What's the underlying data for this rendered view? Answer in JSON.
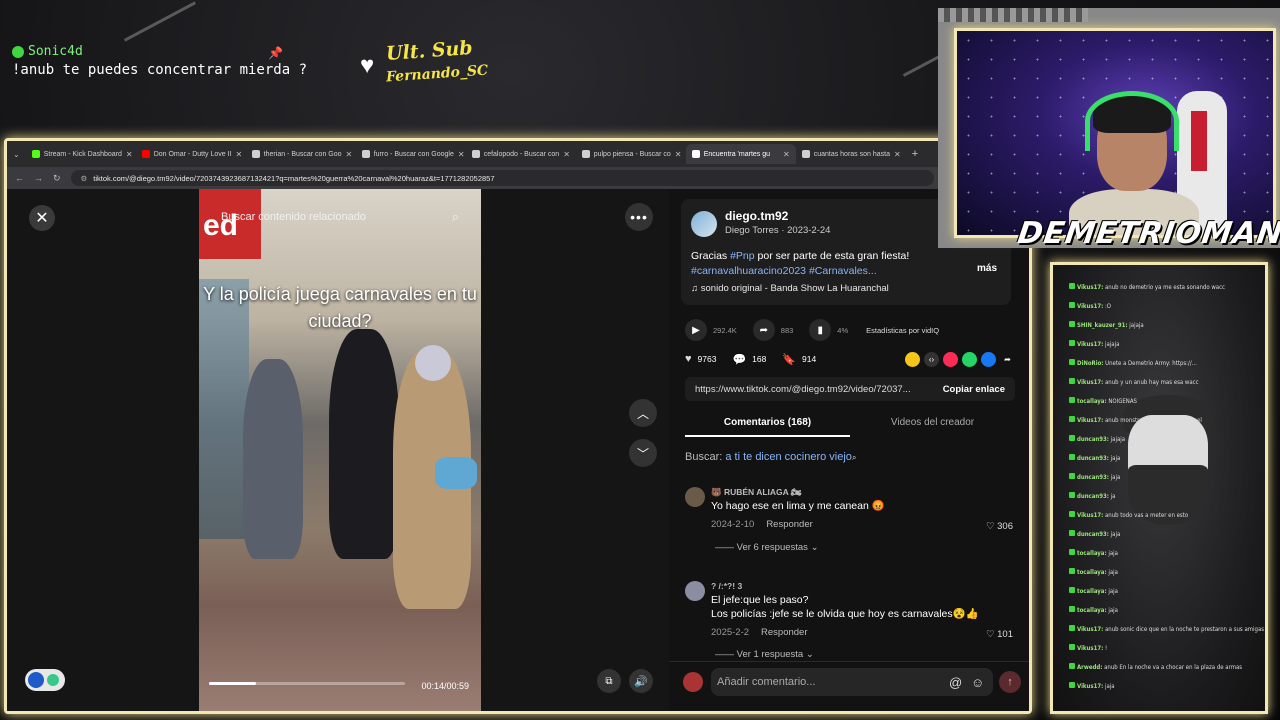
{
  "overlay": {
    "chat_user": "Sonic4d",
    "chat_message": "!anub te puedes concentrar mierda ?",
    "sub_title": "Ult. Sub",
    "sub_name": "Fernando_SC",
    "cam_name": "DEMETRIOMAN...."
  },
  "browser": {
    "tabs": [
      {
        "label": "Stream - Kick Dashboard",
        "color": "#53fc18"
      },
      {
        "label": "Don Omar - Dutty Love II",
        "color": "#ff0000"
      },
      {
        "label": "therian - Buscar con Goo",
        "color": "#cfcfcf"
      },
      {
        "label": "furro - Buscar con Google",
        "color": "#cfcfcf"
      },
      {
        "label": "cefalopodo - Buscar con",
        "color": "#cfcfcf"
      },
      {
        "label": "pulpo piensa - Buscar co",
        "color": "#cfcfcf"
      },
      {
        "label": "Encuentra 'martes gu",
        "color": "#ffffff"
      },
      {
        "label": "cuantas horas son hasta",
        "color": "#cfcfcf"
      }
    ],
    "url": "tiktok.com/@diego.tm92/video/7203743923687132421?q=martes%20guerra%20carnaval%20huaraz&t=1771282052857"
  },
  "video": {
    "search_placeholder": "Buscar contenido relacionado",
    "caption": "Y la policía juega carnavales en tu ciudad?",
    "time": "00:14/00:59",
    "progress": 0.24,
    "store_sign": "ed"
  },
  "post": {
    "handle": "diego.tm92",
    "author_meta": "Diego Torres · 2023-2-24",
    "desc_plain": "Gracias ",
    "desc_tag1": "#Pnp",
    "desc_mid": " por ser parte de esta gran fiesta!",
    "desc_tag2": "#carnavalhuaracino2023",
    "desc_tag3": "#Carnavales...",
    "more": "más",
    "music": "sonido original - Banda Show La Huaranchal",
    "plays": "292.4K",
    "shares_small": "883",
    "pct": "4%",
    "vidiq": "Estadísticas por vidIQ",
    "likes": "9763",
    "comments": "168",
    "saves": "914",
    "link": "https://www.tiktok.com/@diego.tm92/video/72037...",
    "copy_link": "Copiar enlace"
  },
  "comments_section": {
    "tab_comments": "Comentarios (168)",
    "tab_videos": "Videos del creador",
    "search_label": "Buscar:",
    "search_suggestion": "a ti te dicen cocinero viejo",
    "items": [
      {
        "user": "🐻 RUBÉN ALIAGA 🏍",
        "text": "Yo hago ese en lima y me canean 😡",
        "date": "2024-2-10",
        "reply": "Responder",
        "likes": "306",
        "replies": "Ver 6 respuestas"
      },
      {
        "user": "? /:*?! 3",
        "text": "El jefe:que les paso?",
        "text2": "Los policías :jefe se le olvida que hoy es carnavales😵👍",
        "date": "2025-2-2",
        "reply": "Responder",
        "likes": "101",
        "replies": "Ver 1 respuesta"
      }
    ],
    "input_placeholder": "Añadir comentario..."
  },
  "chat_panel": {
    "lines": [
      {
        "user": "Vikus17:",
        "text": "anub no demetrio ya me esta sonando wacc"
      },
      {
        "user": "Vikus17:",
        "text": ":O"
      },
      {
        "user": "SHIN_kauzer_91:",
        "text": "jajaja"
      },
      {
        "user": "Vikus17:",
        "text": "jajaja"
      },
      {
        "user": "DiNoRio:",
        "text": "Unete a Demetrio Army: https://..."
      },
      {
        "user": "Vikus17:",
        "text": "anub y un anub hay mas esa wacc"
      },
      {
        "user": "tocallaya:",
        "text": "NOIGENAS"
      },
      {
        "user": "Vikus17:",
        "text": "anub monstruo de tinta estoy ppoel"
      },
      {
        "user": "duncan93:",
        "text": "jajaja"
      },
      {
        "user": "duncan93:",
        "text": "jaja"
      },
      {
        "user": "duncan93:",
        "text": "jaja"
      },
      {
        "user": "duncan93:",
        "text": "ja"
      },
      {
        "user": "Vikus17:",
        "text": "anub todo vas a meter en esto"
      },
      {
        "user": "duncan93:",
        "text": "jaja"
      },
      {
        "user": "tocallaya:",
        "text": "jaja"
      },
      {
        "user": "tocallaya:",
        "text": "jaja"
      },
      {
        "user": "tocallaya:",
        "text": "jaja"
      },
      {
        "user": "tocallaya:",
        "text": "jaja"
      },
      {
        "user": "Vikus17:",
        "text": "anub sonic dice que en la noche te prestaron a sus amigas"
      },
      {
        "user": "Vikus17:",
        "text": "!"
      },
      {
        "user": "Arwedd:",
        "text": "anub En la noche va a chocar en la plaza de armas"
      },
      {
        "user": "Vikus17:",
        "text": "jaja"
      }
    ]
  }
}
